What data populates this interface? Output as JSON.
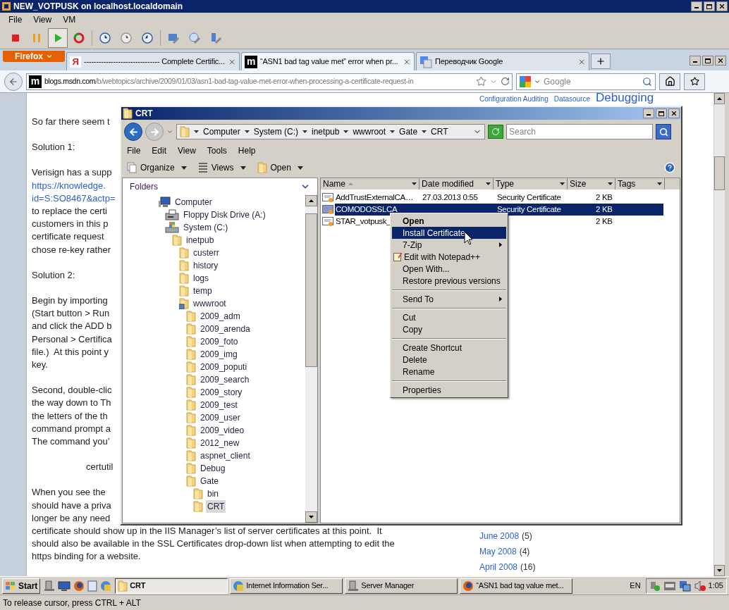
{
  "vm_window": {
    "title": "NEW_VOTPUSK on localhost.localdomain",
    "menu": [
      "File",
      "View",
      "VM"
    ]
  },
  "browser": {
    "firefox_button": "Firefox",
    "tabs": [
      {
        "label": "------------------------------- Complete Certific...",
        "selected": false,
        "kind": "letter-red",
        "icon_text": "Я"
      },
      {
        "label": "“ASN1 bad tag value met” error when pr...",
        "selected": true,
        "kind": "letter-dark",
        "icon_text": "m"
      },
      {
        "label": "Переводчик Google",
        "selected": false,
        "kind": "translate"
      }
    ],
    "site_icon_text": "m",
    "url_host": "blogs.msdn.com",
    "url_path": "/b/webtopics/archive/2009/01/03/asn1-bad-tag-value-met-error-when-processing-a-certificate-request-in",
    "search_placeholder": "Google"
  },
  "article": {
    "paragraphs": [
      {
        "lines": [
          {
            "kind": "text",
            "text": "So far there seem t"
          }
        ]
      },
      {
        "lines": [
          {
            "kind": "text",
            "text": "Solution 1:"
          }
        ]
      },
      {
        "lines": [
          {
            "kind": "text",
            "text": "Verisign has a supp"
          },
          {
            "kind": "link",
            "text": "https://knowledge."
          },
          {
            "kind": "link",
            "text": "id=S:SO8467&actp="
          },
          {
            "kind": "text",
            "text": "to replace the certi"
          },
          {
            "kind": "text",
            "text": "customers in this p"
          },
          {
            "kind": "text",
            "text": "certificate request"
          },
          {
            "kind": "text",
            "text": "chose re-key rather"
          }
        ]
      },
      {
        "lines": [
          {
            "kind": "text",
            "text": "Solution 2:"
          }
        ]
      },
      {
        "lines": [
          {
            "kind": "text",
            "text": "Begin by importing"
          },
          {
            "kind": "text",
            "text": "(Start button > Run"
          },
          {
            "kind": "text",
            "text": "and click the ADD b"
          },
          {
            "kind": "text",
            "text": "Personal > Certifica"
          },
          {
            "kind": "text",
            "text": "file.)  At this point y"
          },
          {
            "kind": "text",
            "text": "key."
          }
        ]
      },
      {
        "lines": [
          {
            "kind": "text",
            "text": "Second, double-clic"
          },
          {
            "kind": "text",
            "text": "the way down to Th"
          },
          {
            "kind": "text",
            "text": "the letters of the th"
          },
          {
            "kind": "text",
            "text": "command prompt a"
          },
          {
            "kind": "text",
            "text": "The command you’"
          }
        ]
      },
      {
        "lines": [
          {
            "kind": "indented",
            "text": "certutil"
          }
        ]
      },
      {
        "lines": [
          {
            "kind": "text",
            "text": "When you see the"
          },
          {
            "kind": "text",
            "text": "should have a priva"
          },
          {
            "kind": "text",
            "text": "longer be any need"
          },
          {
            "kind": "text",
            "text": "certificate should show up in the IIS Manager’s list of server certificates at this point.  It"
          },
          {
            "kind": "text",
            "text": "should also be available in the SSL Certificates drop-down list when attempting to edit the"
          },
          {
            "kind": "text",
            "text": "https binding for a website."
          }
        ]
      }
    ]
  },
  "sidebar": {
    "tags": [
      {
        "text": "Configuration Auditing",
        "kind": "small"
      },
      {
        "text": "Datasource",
        "kind": "small"
      },
      {
        "text": "Debugging",
        "kind": "large"
      }
    ],
    "archive": [
      {
        "month": "June 2008",
        "count": "(5)"
      },
      {
        "month": "May 2008",
        "count": "(4)"
      },
      {
        "month": "April 2008",
        "count": "(16)"
      }
    ]
  },
  "explorer": {
    "title": "CRT",
    "breadcrumb": [
      "Computer",
      "System (C:)",
      "inetpub",
      "wwwroot",
      "Gate",
      "CRT"
    ],
    "search_placeholder": "Search",
    "menu": [
      "File",
      "Edit",
      "View",
      "Tools",
      "Help"
    ],
    "toolbar": [
      "Organize",
      "Views",
      "Open"
    ],
    "folders_label": "Folders",
    "tree": [
      {
        "label": "Computer",
        "kind": "computer",
        "selected": false,
        "children": [
          {
            "label": "Floppy Disk Drive (A:)",
            "kind": "floppy",
            "selected": false
          },
          {
            "label": "System (C:)",
            "kind": "drive",
            "selected": false,
            "children": [
              {
                "label": "inetpub",
                "kind": "folder",
                "selected": false,
                "children": [
                  {
                    "label": "custerr",
                    "kind": "folder",
                    "selected": false
                  },
                  {
                    "label": "history",
                    "kind": "folder",
                    "selected": false
                  },
                  {
                    "label": "logs",
                    "kind": "folder",
                    "selected": false
                  },
                  {
                    "label": "temp",
                    "kind": "folder",
                    "selected": false
                  },
                  {
                    "label": "wwwroot",
                    "kind": "web-folder",
                    "selected": false,
                    "children": [
                      {
                        "label": "2009_adm",
                        "kind": "folder",
                        "selected": false
                      },
                      {
                        "label": "2009_arenda",
                        "kind": "folder",
                        "selected": false
                      },
                      {
                        "label": "2009_foto",
                        "kind": "folder",
                        "selected": false
                      },
                      {
                        "label": "2009_img",
                        "kind": "folder",
                        "selected": false
                      },
                      {
                        "label": "2009_poputi",
                        "kind": "folder",
                        "selected": false
                      },
                      {
                        "label": "2009_search",
                        "kind": "folder",
                        "selected": false
                      },
                      {
                        "label": "2009_story",
                        "kind": "folder",
                        "selected": false
                      },
                      {
                        "label": "2009_test",
                        "kind": "folder",
                        "selected": false
                      },
                      {
                        "label": "2009_user",
                        "kind": "folder",
                        "selected": false
                      },
                      {
                        "label": "2009_video",
                        "kind": "folder",
                        "selected": false
                      },
                      {
                        "label": "2012_new",
                        "kind": "folder",
                        "selected": false
                      },
                      {
                        "label": "aspnet_client",
                        "kind": "folder",
                        "selected": false
                      },
                      {
                        "label": "Debug",
                        "kind": "folder",
                        "selected": false
                      },
                      {
                        "label": "Gate",
                        "kind": "folder",
                        "selected": false,
                        "children": [
                          {
                            "label": "bin",
                            "kind": "folder",
                            "selected": false
                          },
                          {
                            "label": "CRT",
                            "kind": "folder",
                            "selected": true
                          }
                        ]
                      }
                    ]
                  }
                ]
              }
            ]
          }
        ]
      }
    ],
    "columns": [
      "Name",
      "Date modified",
      "Type",
      "Size",
      "Tags"
    ],
    "files": [
      {
        "name": "AddTrustExternalCA…",
        "date": "27.03.2013 0:55",
        "type": "Security Certificate",
        "size": "2 KB",
        "selected": false
      },
      {
        "name": "COMODOSSLCA",
        "type": "Security Certificate",
        "size": "2 KB",
        "selected": true
      },
      {
        "name": "STAR_votpusk_",
        "size": "2 KB",
        "selected": false
      }
    ]
  },
  "context_menu": [
    {
      "kind": "default",
      "label": "Open",
      "selected": false
    },
    {
      "kind": "item",
      "label": "Install Certificate",
      "selected": true
    },
    {
      "kind": "submenu",
      "label": "7-Zip",
      "selected": false
    },
    {
      "kind": "icon-item",
      "label": "Edit with Notepad++",
      "selected": false
    },
    {
      "kind": "item",
      "label": "Open With...",
      "selected": false
    },
    {
      "kind": "item",
      "label": "Restore previous versions",
      "selected": false
    },
    {
      "kind": "separator"
    },
    {
      "kind": "submenu",
      "label": "Send To",
      "selected": false
    },
    {
      "kind": "separator"
    },
    {
      "kind": "item",
      "label": "Cut",
      "selected": false
    },
    {
      "kind": "item",
      "label": "Copy",
      "selected": false
    },
    {
      "kind": "separator"
    },
    {
      "kind": "item",
      "label": "Create Shortcut",
      "selected": false
    },
    {
      "kind": "item",
      "label": "Delete",
      "selected": false
    },
    {
      "kind": "item",
      "label": "Rename",
      "selected": false
    },
    {
      "kind": "separator"
    },
    {
      "kind": "item",
      "label": "Properties",
      "selected": false
    }
  ],
  "taskbar": {
    "start": "Start",
    "tasks": [
      {
        "label": "CRT",
        "kind": "folder",
        "selected": true
      },
      {
        "label": "Internet Information Ser...",
        "kind": "globe",
        "selected": false
      },
      {
        "label": "Server Manager",
        "kind": "server",
        "selected": false
      },
      {
        "label": "“ASN1 bad tag value met...",
        "kind": "firefox",
        "selected": false
      }
    ],
    "language": "EN",
    "clock": "1:05"
  },
  "status_bar": "To release cursor, press CTRL + ALT"
}
